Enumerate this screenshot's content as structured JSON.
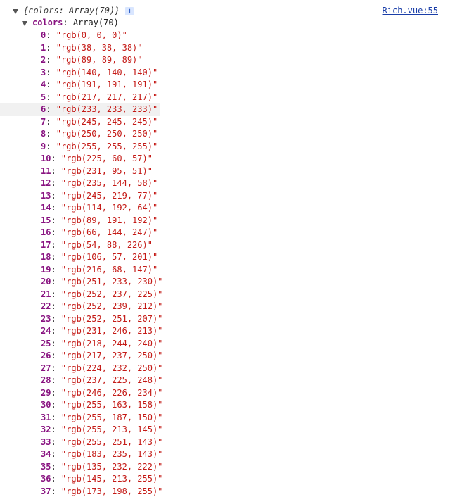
{
  "summary": {
    "open_brace": "{",
    "key": "colors",
    "type": "Array(70)",
    "close_brace": "}",
    "badge": "i"
  },
  "source_link": "Rich.vue:55",
  "property": {
    "key": "colors",
    "type": "Array(70)"
  },
  "highlighted_index": 6,
  "items": [
    {
      "index": "0",
      "value": "\"rgb(0, 0, 0)\""
    },
    {
      "index": "1",
      "value": "\"rgb(38, 38, 38)\""
    },
    {
      "index": "2",
      "value": "\"rgb(89, 89, 89)\""
    },
    {
      "index": "3",
      "value": "\"rgb(140, 140, 140)\""
    },
    {
      "index": "4",
      "value": "\"rgb(191, 191, 191)\""
    },
    {
      "index": "5",
      "value": "\"rgb(217, 217, 217)\""
    },
    {
      "index": "6",
      "value": "\"rgb(233, 233, 233)\""
    },
    {
      "index": "7",
      "value": "\"rgb(245, 245, 245)\""
    },
    {
      "index": "8",
      "value": "\"rgb(250, 250, 250)\""
    },
    {
      "index": "9",
      "value": "\"rgb(255, 255, 255)\""
    },
    {
      "index": "10",
      "value": "\"rgb(225, 60, 57)\""
    },
    {
      "index": "11",
      "value": "\"rgb(231, 95, 51)\""
    },
    {
      "index": "12",
      "value": "\"rgb(235, 144, 58)\""
    },
    {
      "index": "13",
      "value": "\"rgb(245, 219, 77)\""
    },
    {
      "index": "14",
      "value": "\"rgb(114, 192, 64)\""
    },
    {
      "index": "15",
      "value": "\"rgb(89, 191, 192)\""
    },
    {
      "index": "16",
      "value": "\"rgb(66, 144, 247)\""
    },
    {
      "index": "17",
      "value": "\"rgb(54, 88, 226)\""
    },
    {
      "index": "18",
      "value": "\"rgb(106, 57, 201)\""
    },
    {
      "index": "19",
      "value": "\"rgb(216, 68, 147)\""
    },
    {
      "index": "20",
      "value": "\"rgb(251, 233, 230)\""
    },
    {
      "index": "21",
      "value": "\"rgb(252, 237, 225)\""
    },
    {
      "index": "22",
      "value": "\"rgb(252, 239, 212)\""
    },
    {
      "index": "23",
      "value": "\"rgb(252, 251, 207)\""
    },
    {
      "index": "24",
      "value": "\"rgb(231, 246, 213)\""
    },
    {
      "index": "25",
      "value": "\"rgb(218, 244, 240)\""
    },
    {
      "index": "26",
      "value": "\"rgb(217, 237, 250)\""
    },
    {
      "index": "27",
      "value": "\"rgb(224, 232, 250)\""
    },
    {
      "index": "28",
      "value": "\"rgb(237, 225, 248)\""
    },
    {
      "index": "29",
      "value": "\"rgb(246, 226, 234)\""
    },
    {
      "index": "30",
      "value": "\"rgb(255, 163, 158)\""
    },
    {
      "index": "31",
      "value": "\"rgb(255, 187, 150)\""
    },
    {
      "index": "32",
      "value": "\"rgb(255, 213, 145)\""
    },
    {
      "index": "33",
      "value": "\"rgb(255, 251, 143)\""
    },
    {
      "index": "34",
      "value": "\"rgb(183, 235, 143)\""
    },
    {
      "index": "35",
      "value": "\"rgb(135, 232, 222)\""
    },
    {
      "index": "36",
      "value": "\"rgb(145, 213, 255)\""
    },
    {
      "index": "37",
      "value": "\"rgb(173, 198, 255)\""
    }
  ]
}
